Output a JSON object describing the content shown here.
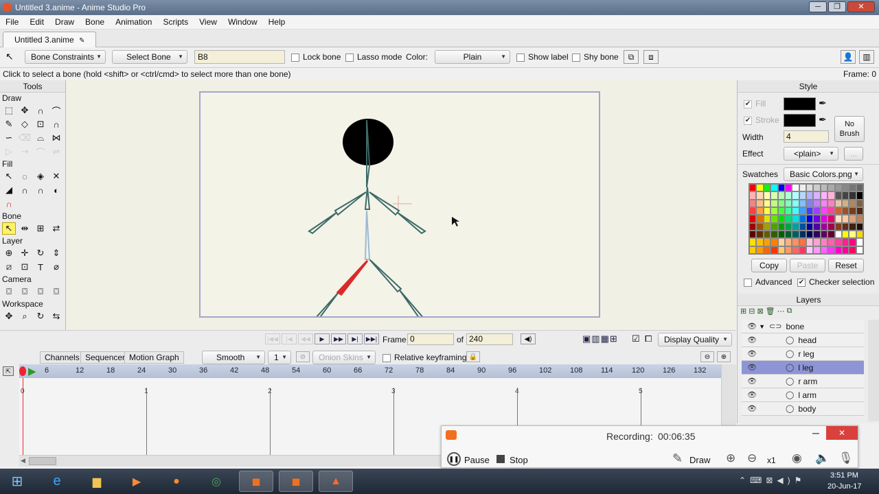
{
  "window": {
    "title": "Untitled 3.anime - Anime Studio Pro"
  },
  "menu": [
    "File",
    "Edit",
    "Draw",
    "Bone",
    "Animation",
    "Scripts",
    "View",
    "Window",
    "Help"
  ],
  "doc_tab": "Untitled 3.anime",
  "toolbar": {
    "constraints": "Bone Constraints",
    "select_bone": "Select Bone",
    "bone_name": "B8",
    "lock_bone": "Lock bone",
    "lasso_mode": "Lasso mode",
    "color_label": "Color:",
    "color_value": "Plain",
    "show_label": "Show label",
    "shy_bone": "Shy bone"
  },
  "status": {
    "hint": "Click to select a bone (hold <shift> or <ctrl/cmd> to select more than one bone)",
    "frame": "Frame: 0"
  },
  "tools": {
    "header": "Tools",
    "draw": "Draw",
    "fill": "Fill",
    "bone": "Bone",
    "layer": "Layer",
    "camera": "Camera",
    "workspace": "Workspace"
  },
  "transport": {
    "frame_label": "Frame",
    "frame_value": "0",
    "of_label": "of",
    "of_value": "240",
    "display_quality": "Display Quality"
  },
  "timeline": {
    "tabs": [
      "Channels",
      "Sequencer",
      "Motion Graph"
    ],
    "interp": "Smooth",
    "step": "1",
    "onion": "Onion Skins",
    "relative": "Relative keyframing",
    "ruler": [
      "6",
      "12",
      "18",
      "24",
      "30",
      "36",
      "42",
      "48",
      "54",
      "60",
      "66",
      "72",
      "78",
      "84",
      "90",
      "96",
      "102",
      "108",
      "114",
      "120",
      "126",
      "132"
    ],
    "seconds": [
      "0",
      "1",
      "2",
      "3",
      "4",
      "5"
    ]
  },
  "style": {
    "header": "Style",
    "fill": "Fill",
    "stroke": "Stroke",
    "width_label": "Width",
    "width_value": "4",
    "no_brush": "No Brush",
    "effect_label": "Effect",
    "effect_value": "<plain>",
    "effect_more": "...",
    "swatches_label": "Swatches",
    "swatches_value": "Basic Colors.png",
    "copy": "Copy",
    "paste": "Paste",
    "reset": "Reset",
    "advanced": "Advanced",
    "checker": "Checker selection"
  },
  "layers": {
    "header": "Layers",
    "items": [
      {
        "name": "bone",
        "level": 0,
        "selected": false
      },
      {
        "name": "head",
        "level": 1,
        "selected": false
      },
      {
        "name": "r leg",
        "level": 1,
        "selected": false
      },
      {
        "name": "l leg",
        "level": 1,
        "selected": true
      },
      {
        "name": "r arm",
        "level": 1,
        "selected": false
      },
      {
        "name": "l arm",
        "level": 1,
        "selected": false
      },
      {
        "name": "body",
        "level": 1,
        "selected": false
      }
    ]
  },
  "recorder": {
    "status": "Recording:",
    "time": "00:06:35",
    "pause": "Pause",
    "stop": "Stop",
    "draw": "Draw",
    "zoom": "x1"
  },
  "taskbar": {
    "time": "3:51 PM",
    "date": "20-Jun-17"
  }
}
